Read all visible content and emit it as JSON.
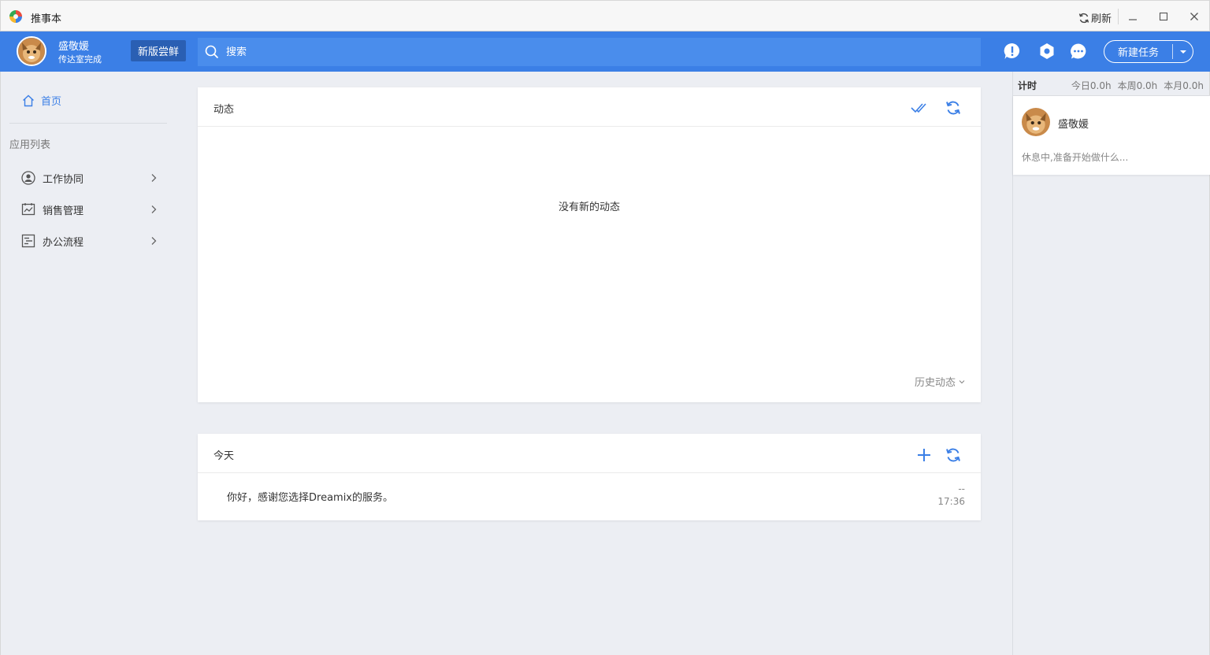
{
  "window": {
    "title": "推事本",
    "refresh_label": "刷新"
  },
  "header": {
    "user_name": "盛敬媛",
    "user_status": "传达室完成",
    "trial_label": "新版尝鲜",
    "search_placeholder": "搜索",
    "new_task_label": "新建任务",
    "accent_color": "#3b7fe6"
  },
  "sidebar": {
    "home_label": "首页",
    "section_heading": "应用列表",
    "items": [
      {
        "label": "工作协同",
        "icon": "person-circle-icon"
      },
      {
        "label": "销售管理",
        "icon": "chart-icon"
      },
      {
        "label": "办公流程",
        "icon": "flow-icon"
      }
    ]
  },
  "activity": {
    "title": "动态",
    "empty_message": "没有新的动态",
    "history_label": "历史动态"
  },
  "today": {
    "title": "今天",
    "items": [
      {
        "message": "你好，感谢您选择Dreamix的服务。",
        "dash": "--",
        "time": "17:36"
      }
    ]
  },
  "timer": {
    "label": "计时",
    "today": "今日0.0h",
    "week": "本周0.0h",
    "month": "本月0.0h",
    "user_name": "盛敬媛",
    "status": "休息中,准备开始做什么..."
  }
}
